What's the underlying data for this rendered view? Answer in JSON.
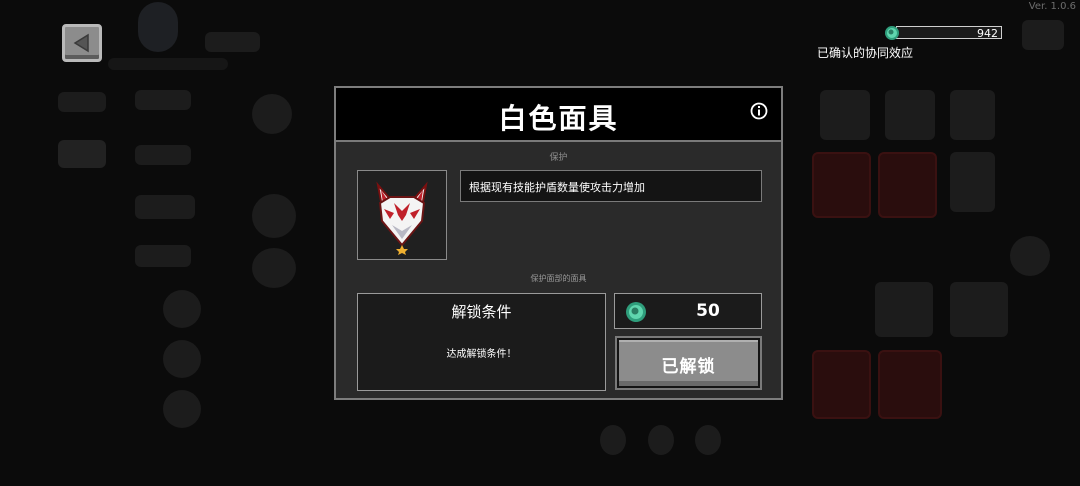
{
  "version": "Ver. 1.0.6",
  "currency": {
    "icon": "gem-icon",
    "count": "942",
    "color": "#35b58c"
  },
  "synergy_link": "已确认的协同效应",
  "modal": {
    "title": "白色面具",
    "info_icon": "info-icon",
    "item_type": "保护",
    "item_icon": "white-fox-mask-icon",
    "description": "根据现有技能护盾数量使攻击力增加",
    "subtitle": "保护面部的面具",
    "unlock": {
      "title": "解锁条件",
      "condition": "达成解锁条件！"
    },
    "cost": {
      "icon": "gem-icon",
      "value": "50"
    },
    "unlocked_label": "已解锁"
  }
}
